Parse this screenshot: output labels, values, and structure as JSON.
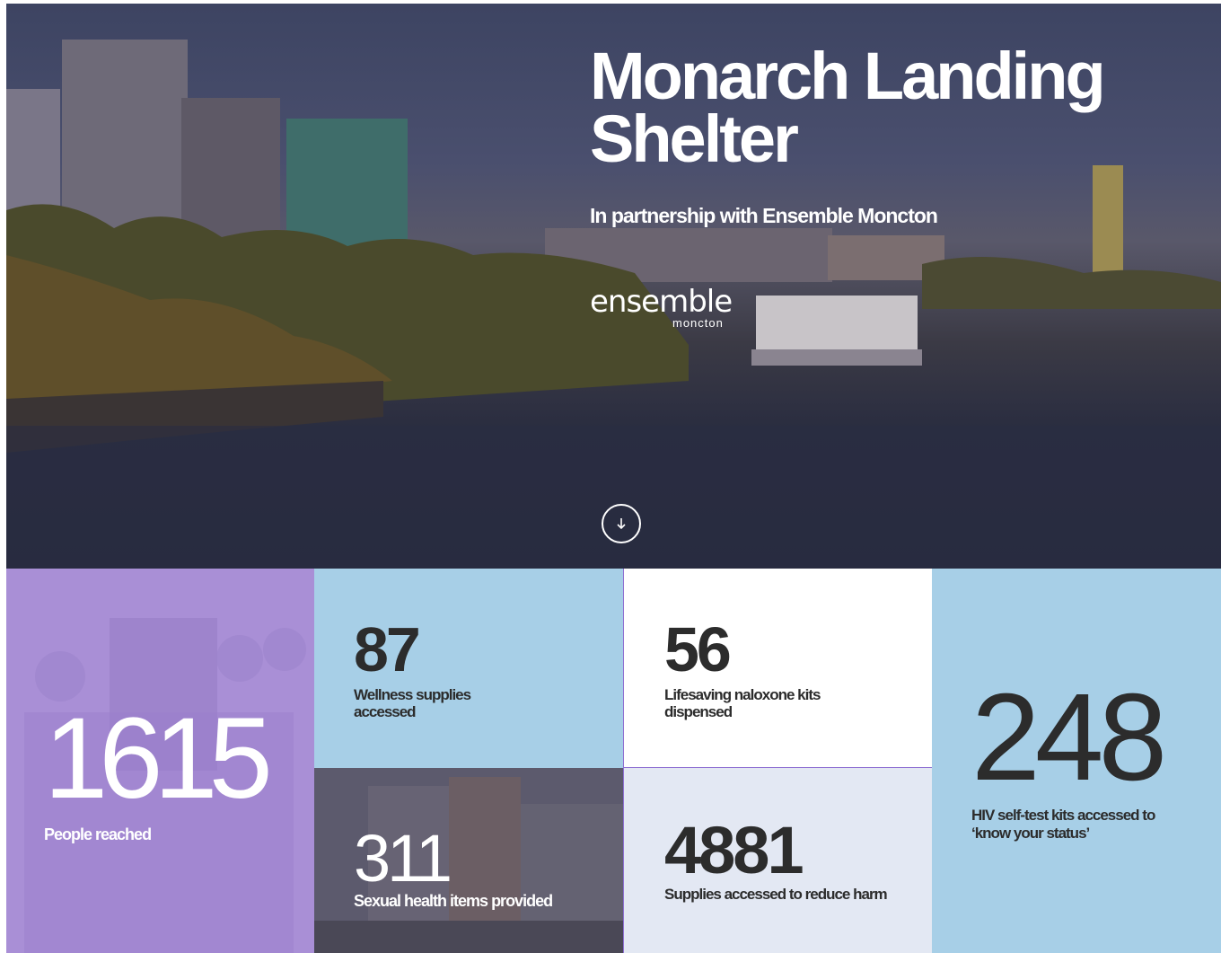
{
  "hero": {
    "title": "Monarch Landing Shelter",
    "subtitle": "In partnership with Ensemble Moncton",
    "logo_word": "ensemble",
    "logo_sub": "moncton",
    "scroll_icon": "arrow-down-circle-icon"
  },
  "stats": [
    {
      "value": "1615",
      "label": "People reached"
    },
    {
      "value": "87",
      "label": "Wellness supplies accessed"
    },
    {
      "value": "56",
      "label": "Lifesaving naloxone kits dispensed"
    },
    {
      "value": "311",
      "label": "Sexual health items provided"
    },
    {
      "value": "4881",
      "label": "Supplies accessed to reduce harm"
    },
    {
      "value": "248",
      "label": "HIV self-test kits accessed to ‘know your status’"
    }
  ],
  "colors": {
    "purple_tile": "#a98fd6",
    "light_blue_tile": "#a7cfe7",
    "pale_tile": "#e3e8f3",
    "divider": "#8e6fd2",
    "dark_text": "#2c2c2c"
  }
}
